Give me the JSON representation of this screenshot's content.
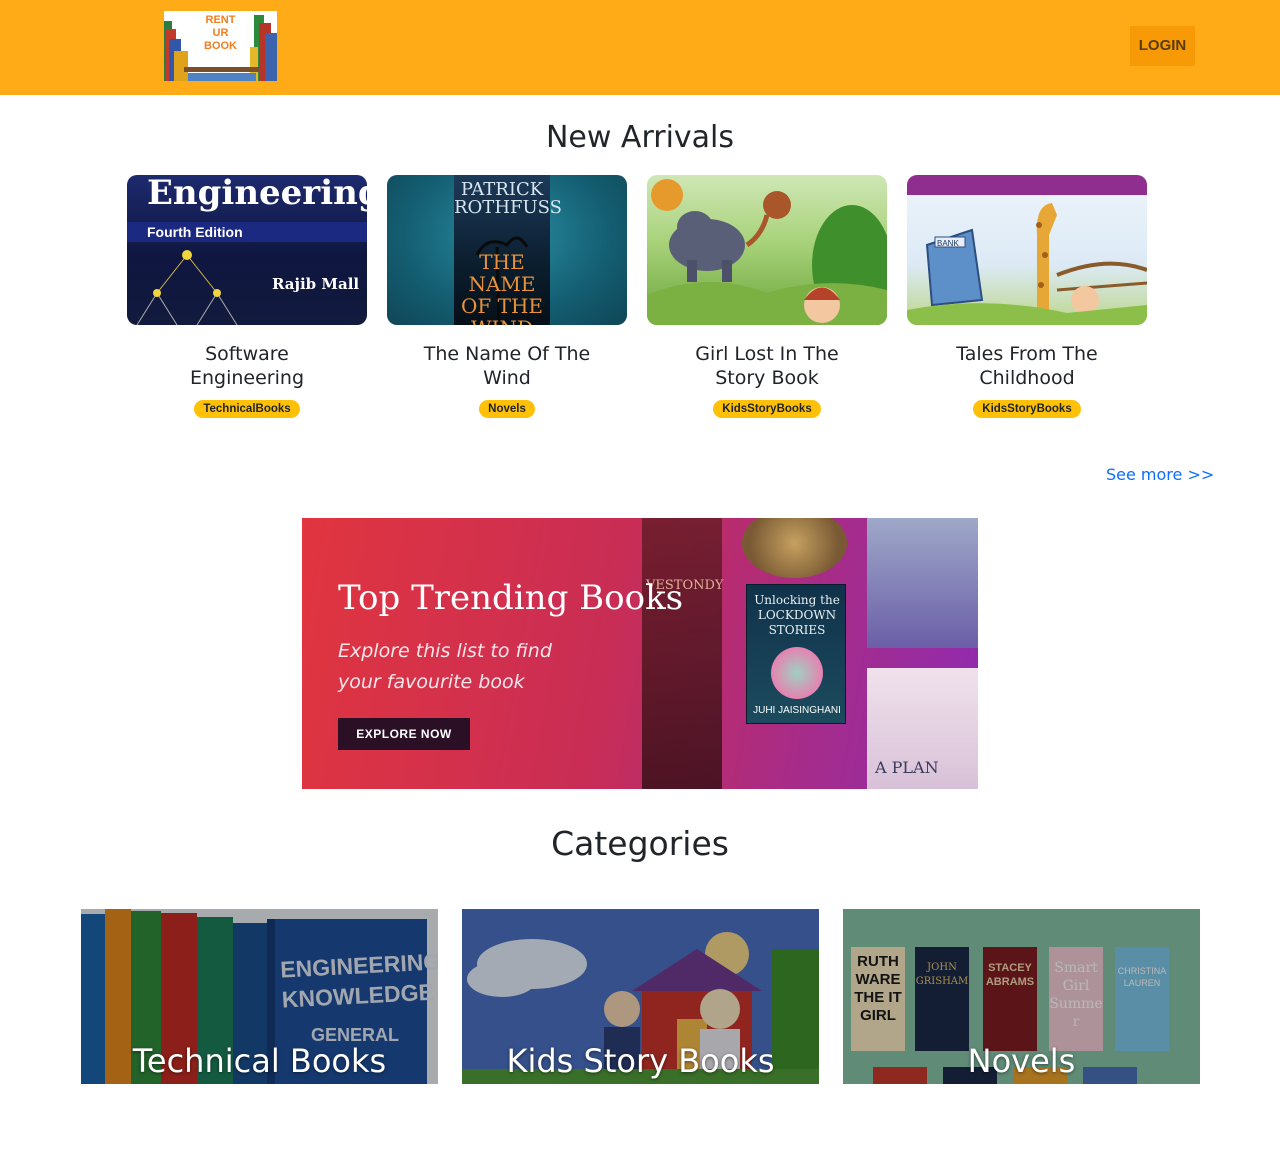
{
  "header": {
    "logo_text": "RENT\nUR\nBOOK",
    "login_label": "LOGIN",
    "background": "#ffab17"
  },
  "new_arrivals": {
    "title": "New Arrivals",
    "books": [
      {
        "title": "Software Engineering",
        "category": "TechnicalBooks",
        "cover": {
          "line1": "Engineering",
          "line2": "Fourth Edition",
          "line3": "Rajib Mall"
        }
      },
      {
        "title": "The Name Of The Wind",
        "category": "Novels",
        "cover": {
          "line1": "PATRICK ROTHFUSS",
          "line2": "THE NAME OF THE WIND"
        }
      },
      {
        "title": "Girl Lost In The Story Book",
        "category": "KidsStoryBooks",
        "cover": {}
      },
      {
        "title": "Tales From The Childhood",
        "category": "KidsStoryBooks",
        "cover": {
          "line1": "BANK"
        }
      }
    ],
    "see_more": "See more >>"
  },
  "banner": {
    "title": "Top Trending Books",
    "subtitle": "Explore this list to find your favourite book",
    "button": "EXPLORE NOW",
    "covers": [
      {
        "text": "VESTONDY"
      },
      {
        "text": "Unlocking the LOCKDOWN STORIES"
      },
      {
        "text": "JUHI JAISINGHANI"
      },
      {
        "text": "A PLAN"
      }
    ]
  },
  "categories": {
    "title": "Categories",
    "items": [
      {
        "label": "Technical Books",
        "spine_text": "ENGINEERING KNOWLEDGE",
        "spine_sub": "GENERAL"
      },
      {
        "label": "Kids Story Books"
      },
      {
        "label": "Novels",
        "covers": [
          "RUTH WARE THE IT GIRL",
          "JOHN GRISHAM",
          "STACEY ABRAMS",
          "Smart Girl Summer",
          "CHRISTINA LAUREN"
        ]
      }
    ]
  },
  "colors": {
    "accent": "#ffab17",
    "badge": "#ffc107",
    "link": "#0d6efd"
  }
}
